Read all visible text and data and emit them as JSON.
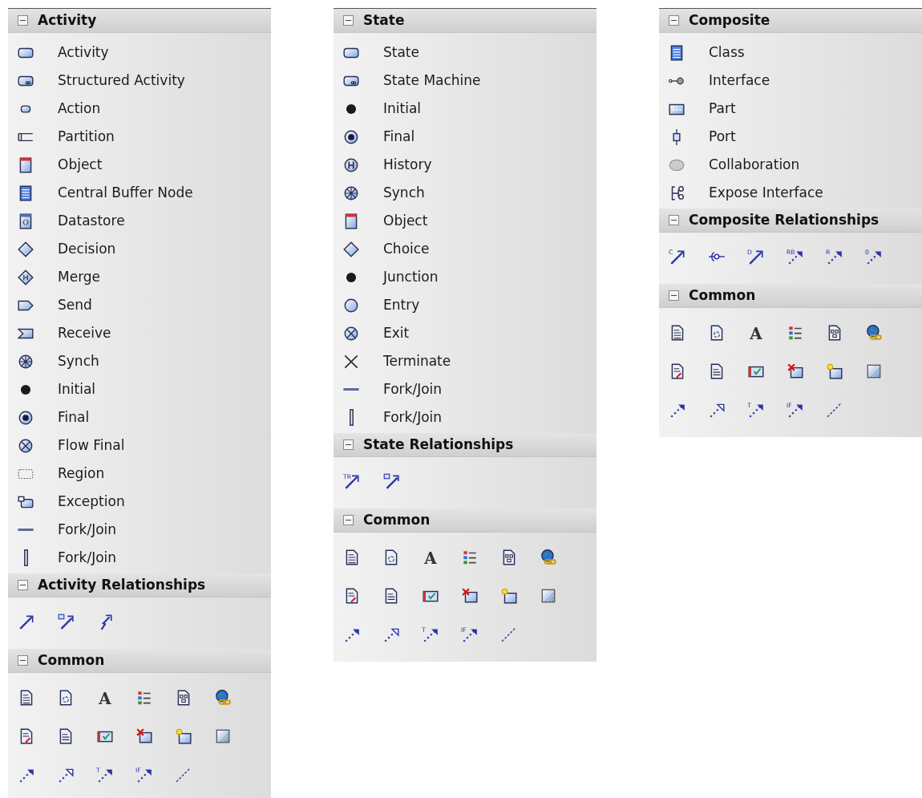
{
  "panels": [
    {
      "sections": [
        {
          "title": "Activity",
          "expanded": true,
          "kind": "list",
          "items": [
            {
              "label": "Activity",
              "kind": "activity"
            },
            {
              "label": "Structured Activity",
              "kind": "structured"
            },
            {
              "label": "Action",
              "kind": "action"
            },
            {
              "label": "Partition",
              "kind": "partition"
            },
            {
              "label": "Object",
              "kind": "object"
            },
            {
              "label": "Central Buffer Node",
              "kind": "buffer"
            },
            {
              "label": "Datastore",
              "kind": "datastore"
            },
            {
              "label": "Decision",
              "kind": "decision"
            },
            {
              "label": "Merge",
              "kind": "merge"
            },
            {
              "label": "Send",
              "kind": "send"
            },
            {
              "label": "Receive",
              "kind": "receive"
            },
            {
              "label": "Synch",
              "kind": "synch"
            },
            {
              "label": "Initial",
              "kind": "initial"
            },
            {
              "label": "Final",
              "kind": "final"
            },
            {
              "label": "Flow Final",
              "kind": "flowfinal"
            },
            {
              "label": "Region",
              "kind": "region"
            },
            {
              "label": "Exception",
              "kind": "exception"
            },
            {
              "label": "Fork/Join",
              "kind": "forkh"
            },
            {
              "label": "Fork/Join",
              "kind": "forkv"
            }
          ]
        },
        {
          "title": "Activity Relationships",
          "expanded": true,
          "kind": "grid",
          "rows": [
            [
              {
                "kind": "arrow"
              },
              {
                "kind": "docarrow"
              },
              {
                "kind": "lightning"
              }
            ]
          ]
        },
        {
          "title": "Common",
          "expanded": true,
          "kind": "grid",
          "rows": [
            [
              {
                "kind": "note"
              },
              {
                "kind": "doccycle"
              },
              {
                "kind": "letter",
                "glyph": "A"
              },
              {
                "kind": "list"
              },
              {
                "kind": "diagramdoc"
              },
              {
                "kind": "globe"
              }
            ],
            [
              {
                "kind": "docpen"
              },
              {
                "kind": "doc"
              },
              {
                "kind": "check"
              },
              {
                "kind": "xframe"
              },
              {
                "kind": "starframe"
              },
              {
                "kind": "hatch"
              }
            ],
            [
              {
                "kind": "dotarrow"
              },
              {
                "kind": "dotarrowhollow"
              },
              {
                "kind": "dotarrow",
                "tag": "T"
              },
              {
                "kind": "dotarrow",
                "tag": "IF"
              },
              {
                "kind": "dashline"
              }
            ]
          ]
        }
      ]
    },
    {
      "sections": [
        {
          "title": "State",
          "expanded": true,
          "kind": "list",
          "items": [
            {
              "label": "State",
              "kind": "activity"
            },
            {
              "label": "State Machine",
              "kind": "structured"
            },
            {
              "label": "Initial",
              "kind": "initial"
            },
            {
              "label": "Final",
              "kind": "final"
            },
            {
              "label": "History",
              "kind": "history"
            },
            {
              "label": "Synch",
              "kind": "synch"
            },
            {
              "label": "Object",
              "kind": "object"
            },
            {
              "label": "Choice",
              "kind": "decision"
            },
            {
              "label": "Junction",
              "kind": "initial"
            },
            {
              "label": "Entry",
              "kind": "entry"
            },
            {
              "label": "Exit",
              "kind": "flowfinal"
            },
            {
              "label": "Terminate",
              "kind": "terminate"
            },
            {
              "label": "Fork/Join",
              "kind": "forkh"
            },
            {
              "label": "Fork/Join",
              "kind": "forkv"
            }
          ]
        },
        {
          "title": "State Relationships",
          "expanded": true,
          "kind": "grid",
          "rows": [
            [
              {
                "kind": "arrow",
                "tag": "TR"
              },
              {
                "kind": "docarrow"
              }
            ]
          ]
        },
        {
          "title": "Common",
          "expanded": true,
          "kind": "grid",
          "rows": [
            [
              {
                "kind": "note"
              },
              {
                "kind": "doccycle"
              },
              {
                "kind": "letter",
                "glyph": "A"
              },
              {
                "kind": "list"
              },
              {
                "kind": "diagramdoc"
              },
              {
                "kind": "globe"
              }
            ],
            [
              {
                "kind": "docpen"
              },
              {
                "kind": "doc"
              },
              {
                "kind": "check"
              },
              {
                "kind": "xframe"
              },
              {
                "kind": "starframe"
              },
              {
                "kind": "hatch"
              }
            ],
            [
              {
                "kind": "dotarrow"
              },
              {
                "kind": "dotarrowhollow"
              },
              {
                "kind": "dotarrow",
                "tag": "T"
              },
              {
                "kind": "dotarrow",
                "tag": "IF"
              },
              {
                "kind": "dashline"
              }
            ]
          ]
        }
      ]
    },
    {
      "sections": [
        {
          "title": "Composite",
          "expanded": true,
          "kind": "list",
          "items": [
            {
              "label": "Class",
              "kind": "buffer"
            },
            {
              "label": "Interface",
              "kind": "interface"
            },
            {
              "label": "Part",
              "kind": "part"
            },
            {
              "label": "Port",
              "kind": "port"
            },
            {
              "label": "Collaboration",
              "kind": "collab"
            },
            {
              "label": "Expose Interface",
              "kind": "expose"
            }
          ]
        },
        {
          "title": "Composite Relationships",
          "expanded": true,
          "kind": "grid",
          "rows": [
            [
              {
                "kind": "arrow",
                "tag": "C"
              },
              {
                "kind": "lollipop"
              },
              {
                "kind": "arrow",
                "tag": "D"
              },
              {
                "kind": "dotarrow",
                "tag": "RB"
              },
              {
                "kind": "dotarrow",
                "tag": "R"
              },
              {
                "kind": "dotarrow",
                "tag": "0"
              }
            ]
          ]
        },
        {
          "title": "Common",
          "expanded": true,
          "kind": "grid",
          "rows": [
            [
              {
                "kind": "note"
              },
              {
                "kind": "doccycle"
              },
              {
                "kind": "letter",
                "glyph": "A"
              },
              {
                "kind": "list"
              },
              {
                "kind": "diagramdoc"
              },
              {
                "kind": "globe"
              }
            ],
            [
              {
                "kind": "docpen"
              },
              {
                "kind": "doc"
              },
              {
                "kind": "check"
              },
              {
                "kind": "xframe"
              },
              {
                "kind": "starframe"
              },
              {
                "kind": "hatch"
              }
            ],
            [
              {
                "kind": "dotarrow"
              },
              {
                "kind": "dotarrowhollow"
              },
              {
                "kind": "dotarrow",
                "tag": "T"
              },
              {
                "kind": "dotarrow",
                "tag": "IF"
              },
              {
                "kind": "dashline"
              }
            ]
          ]
        }
      ]
    }
  ]
}
